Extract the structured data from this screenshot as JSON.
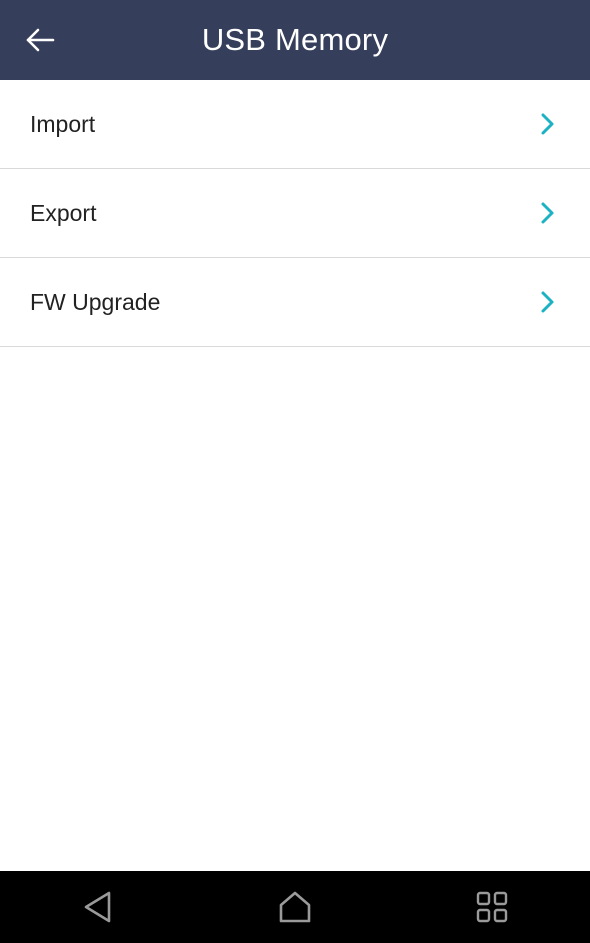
{
  "header": {
    "title": "USB Memory",
    "back_icon": "arrow-left-icon",
    "background": "#353e5a"
  },
  "menu": {
    "items": [
      {
        "label": "Import",
        "icon": "chevron-right-icon"
      },
      {
        "label": "Export",
        "icon": "chevron-right-icon"
      },
      {
        "label": "FW Upgrade",
        "icon": "chevron-right-icon"
      }
    ],
    "accent": "#1bb3c4"
  },
  "navbar": {
    "buttons": [
      "back-triangle-icon",
      "home-icon",
      "apps-grid-icon"
    ]
  }
}
